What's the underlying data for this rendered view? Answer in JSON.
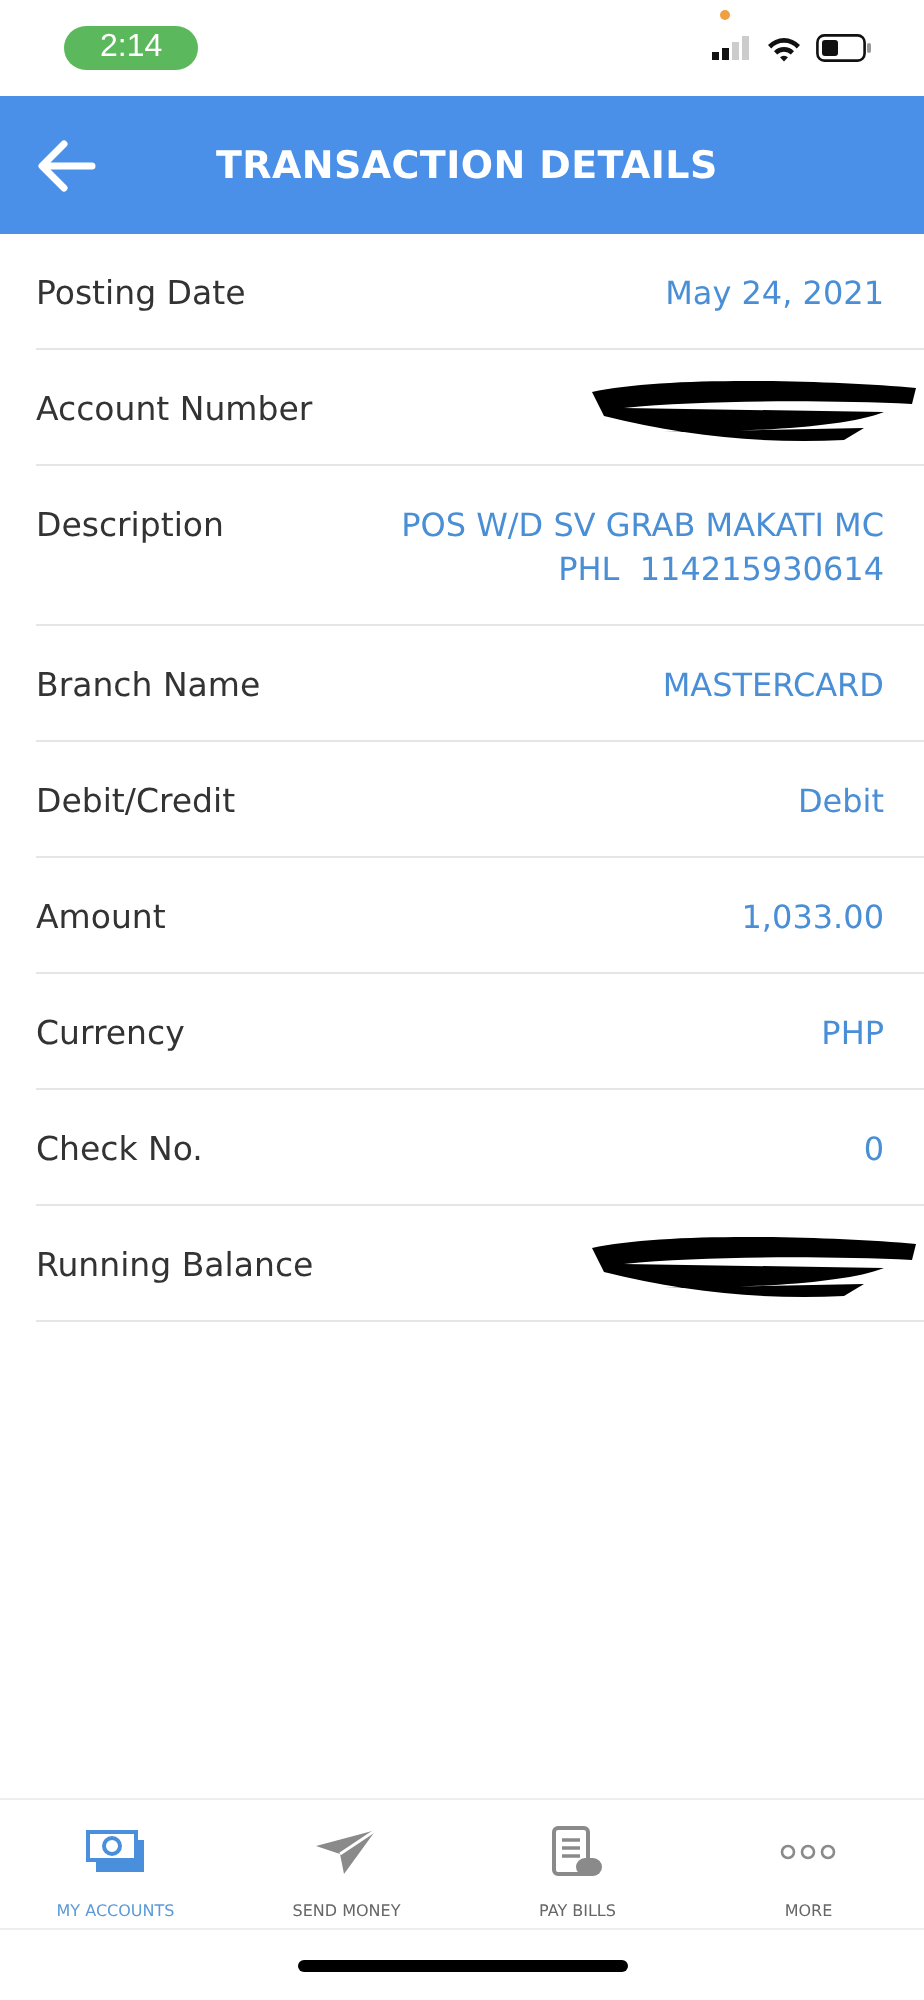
{
  "status_bar": {
    "time": "2:14"
  },
  "header": {
    "title": "TRANSACTION DETAILS"
  },
  "details": [
    {
      "label": "Posting Date",
      "kind": "text",
      "value": "May 24, 2021"
    },
    {
      "label": "Account Number",
      "kind": "redacted"
    },
    {
      "label": "Description",
      "kind": "text",
      "value": "POS W/D SV GRAB MAKATI MC\nPHL  114215930614"
    },
    {
      "label": "Branch Name",
      "kind": "text",
      "value": "MASTERCARD"
    },
    {
      "label": "Debit/Credit",
      "kind": "text",
      "value": "Debit"
    },
    {
      "label": "Amount",
      "kind": "text",
      "value": "1,033.00"
    },
    {
      "label": "Currency",
      "kind": "text",
      "value": "PHP"
    },
    {
      "label": "Check No.",
      "kind": "text",
      "value": "0"
    },
    {
      "label": "Running Balance",
      "kind": "redacted"
    }
  ],
  "tab_bar": [
    {
      "label": "MY ACCOUNTS",
      "kind": "accounts",
      "selected": true
    },
    {
      "label": "SEND MONEY",
      "kind": "send",
      "selected": false
    },
    {
      "label": "PAY BILLS",
      "kind": "bills",
      "selected": false
    },
    {
      "label": "MORE",
      "kind": "more",
      "selected": false
    }
  ]
}
